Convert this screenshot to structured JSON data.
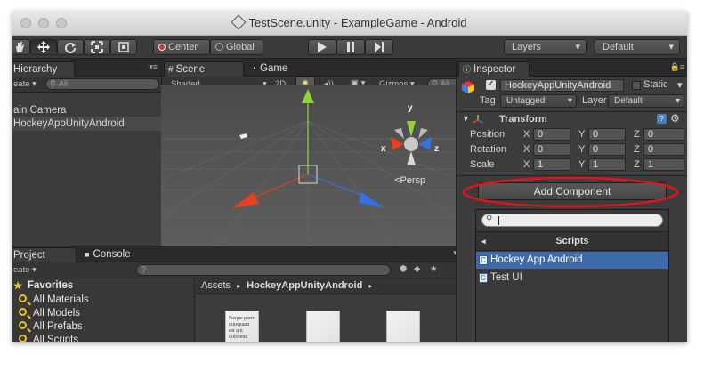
{
  "window": {
    "title": "TestScene.unity - ExampleGame - Android"
  },
  "toolbar": {
    "pivot": "Center",
    "space": "Global",
    "layers": "Layers",
    "layout": "Default"
  },
  "hierarchy": {
    "tab": "Hierarchy",
    "create": "eate",
    "search_placeholder": "All",
    "items": [
      "ain Camera",
      "HockeyAppUnityAndroid"
    ]
  },
  "scene": {
    "tab_scene": "Scene",
    "tab_game": "Game",
    "shading": "Shaded",
    "mode_2d": "2D",
    "gizmos": "Gizmos",
    "search_placeholder": "All",
    "gizmo_labels": {
      "x": "x",
      "y": "y",
      "z": "z"
    },
    "persp": "Persp"
  },
  "project": {
    "tab_project": "Project",
    "tab_console": "Console",
    "create": "eate",
    "favorites_title": "Favorites",
    "favorites": [
      "All Materials",
      "All Models",
      "All Prefabs",
      "All Scripts"
    ],
    "breadcrumb_root": "Assets",
    "breadcrumb_folder": "HockeyAppUnityAndroid",
    "doc_text": "Neque porro quisquam est qui dolorem."
  },
  "inspector": {
    "tab": "Inspector",
    "object_name": "HockeyAppUnityAndroid",
    "static_label": "Static",
    "tag_label": "Tag",
    "tag_value": "Untagged",
    "layer_label": "Layer",
    "layer_value": "Default",
    "component_title": "Transform",
    "rows": [
      {
        "label": "Position",
        "x": "0",
        "y": "0",
        "z": "0"
      },
      {
        "label": "Rotation",
        "x": "0",
        "y": "0",
        "z": "0"
      },
      {
        "label": "Scale",
        "x": "1",
        "y": "1",
        "z": "1"
      }
    ],
    "axis": {
      "x": "X",
      "y": "Y",
      "z": "Z"
    },
    "add_component": "Add Component",
    "scripts_header": "Scripts",
    "scripts": [
      "Hockey App Android",
      "Test UI"
    ]
  },
  "colors": {
    "selection_blue": "#3e6aaa",
    "annotation_red": "#e0141b",
    "x_axis": "#e8401c",
    "y_axis": "#8fd23c",
    "z_axis": "#3571e0"
  }
}
